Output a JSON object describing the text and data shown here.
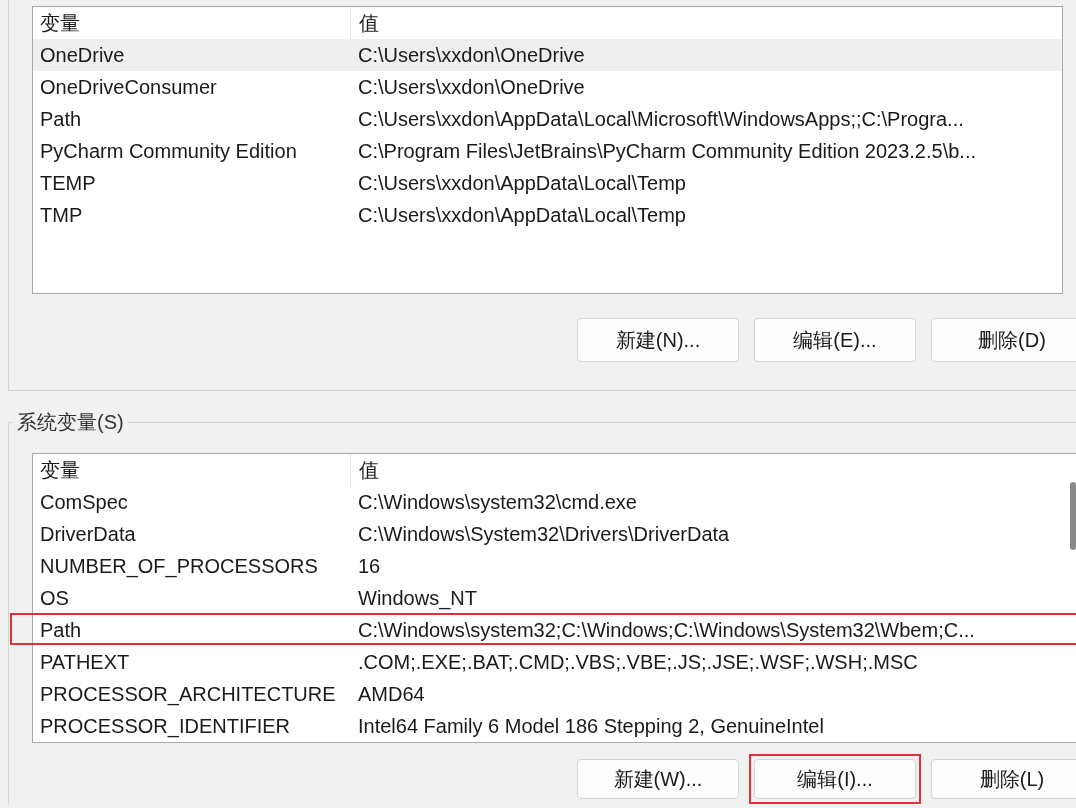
{
  "user_variables": {
    "columns": [
      "变量",
      "值"
    ],
    "rows": [
      {
        "name": "OneDrive",
        "value": "C:\\Users\\xxdon\\OneDrive",
        "selected": true,
        "highlighted": false
      },
      {
        "name": "OneDriveConsumer",
        "value": "C:\\Users\\xxdon\\OneDrive",
        "selected": false,
        "highlighted": false
      },
      {
        "name": "Path",
        "value": "C:\\Users\\xxdon\\AppData\\Local\\Microsoft\\WindowsApps;;C:\\Progra...",
        "selected": false,
        "highlighted": false
      },
      {
        "name": "PyCharm Community Edition",
        "value": "C:\\Program Files\\JetBrains\\PyCharm Community Edition 2023.2.5\\b...",
        "selected": false,
        "highlighted": false
      },
      {
        "name": "TEMP",
        "value": "C:\\Users\\xxdon\\AppData\\Local\\Temp",
        "selected": false,
        "highlighted": false
      },
      {
        "name": "TMP",
        "value": "C:\\Users\\xxdon\\AppData\\Local\\Temp",
        "selected": false,
        "highlighted": false
      }
    ],
    "buttons": [
      {
        "label": "新建(N)...",
        "highlighted": false
      },
      {
        "label": "编辑(E)...",
        "highlighted": false
      },
      {
        "label": "删除(D)",
        "highlighted": false
      }
    ]
  },
  "system_variables": {
    "title": "系统变量(S)",
    "columns": [
      "变量",
      "值"
    ],
    "rows": [
      {
        "name": "ComSpec",
        "value": "C:\\Windows\\system32\\cmd.exe",
        "selected": false,
        "highlighted": false
      },
      {
        "name": "DriverData",
        "value": "C:\\Windows\\System32\\Drivers\\DriverData",
        "selected": false,
        "highlighted": false
      },
      {
        "name": "NUMBER_OF_PROCESSORS",
        "value": "16",
        "selected": false,
        "highlighted": false
      },
      {
        "name": "OS",
        "value": "Windows_NT",
        "selected": false,
        "highlighted": false
      },
      {
        "name": "Path",
        "value": "C:\\Windows\\system32;C:\\Windows;C:\\Windows\\System32\\Wbem;C...",
        "selected": false,
        "highlighted": true
      },
      {
        "name": "PATHEXT",
        "value": ".COM;.EXE;.BAT;.CMD;.VBS;.VBE;.JS;.JSE;.WSF;.WSH;.MSC",
        "selected": false,
        "highlighted": false
      },
      {
        "name": "PROCESSOR_ARCHITECTURE",
        "value": "AMD64",
        "selected": false,
        "highlighted": false
      },
      {
        "name": "PROCESSOR_IDENTIFIER",
        "value": "Intel64 Family 6 Model 186 Stepping 2, GenuineIntel",
        "selected": false,
        "highlighted": false
      }
    ],
    "buttons": [
      {
        "label": "新建(W)...",
        "highlighted": false
      },
      {
        "label": "编辑(I)...",
        "highlighted": true
      },
      {
        "label": "删除(L)",
        "highlighted": false
      }
    ]
  }
}
